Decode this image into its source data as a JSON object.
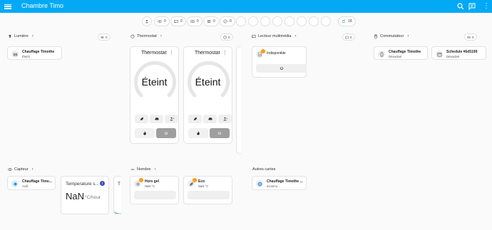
{
  "header": {
    "title": "Chambre Timo"
  },
  "summary_chips": [
    {
      "icon": "person-icon",
      "count": ""
    },
    {
      "icon": "eye-icon",
      "count": "0"
    },
    {
      "icon": "cast-icon",
      "count": "0"
    },
    {
      "icon": "media-player-icon",
      "count": "0"
    },
    {
      "icon": "sliders-icon",
      "count": "0"
    },
    {
      "icon": "check-circle-icon",
      "count": "0"
    }
  ],
  "summary_last_chip": {
    "icon": "refresh-icon",
    "count": "18"
  },
  "sections": {
    "lumiere": {
      "label": "Lumière",
      "badge": "0"
    },
    "thermostat": {
      "label": "Thermostat",
      "badge": "0"
    },
    "media": {
      "label": "Lecteur multimédia",
      "badge": "0"
    },
    "commutateur": {
      "label": "Commutateur",
      "badge": "0"
    },
    "capteur": {
      "label": "Capteur"
    },
    "nombre": {
      "label": "Nombre"
    },
    "autres": {
      "label": "Autres cartes"
    }
  },
  "lumiere_tiles": [
    {
      "name": "Chauffage Timothe",
      "state": "Éteint"
    }
  ],
  "thermostats": [
    {
      "title": "Thermostat",
      "value": "Éteint"
    },
    {
      "title": "Thermostat",
      "value": "Éteint"
    }
  ],
  "media_tile": {
    "name": "",
    "state": "Indisponible"
  },
  "commutateur_tiles": [
    {
      "name": "Chauffage Timothe",
      "state": "Désactivé"
    },
    {
      "name": "Schedule #6d5199",
      "state": "Désactivé"
    }
  ],
  "capteur_tile": {
    "name": "Chauffage Timo...",
    "state": "Actif"
  },
  "graph_card": {
    "title": "Temperature s...",
    "value": "NaN",
    "unit": "°C/hour"
  },
  "graph_card_partial": {
    "title": "T"
  },
  "nombre_tiles": [
    {
      "name": "Hors gel",
      "state": "NaN °C"
    },
    {
      "name": "Eco",
      "state": "NaN °C"
    }
  ],
  "autres_tile": {
    "name": "Chauffage Timothe ...",
    "state": "Inconnu"
  },
  "colors": {
    "accent": "#03a9f4",
    "badge": "#ff9800",
    "info": "#3f51b5",
    "active_blue": "#2196f3"
  }
}
